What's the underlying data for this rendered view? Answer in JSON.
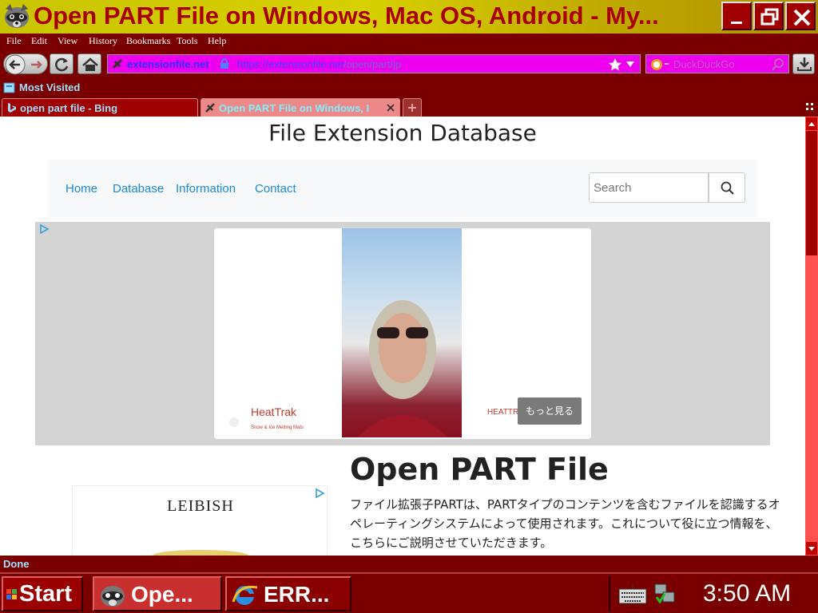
{
  "window": {
    "title": "Open PART File on Windows, Mac OS, Android - My...",
    "controls": [
      "minimize-icon",
      "restore-icon",
      "close-icon"
    ]
  },
  "menu": [
    "File",
    "Edit",
    "View",
    "History",
    "Bookmarks",
    "Tools",
    "Help"
  ],
  "navbar": {
    "domain": "extensionfile.net",
    "url_host": "https://extensionfile.net",
    "url_path": "/open/part/jp",
    "search_placeholder": "DuckDuckGo"
  },
  "bookmarks": {
    "most_visited": "Most Visited"
  },
  "tabs": [
    {
      "label": "open part file - Bing",
      "active": false
    },
    {
      "label": "Open PART File on Windows, I",
      "active": true
    }
  ],
  "page": {
    "site_title": "File Extension Database",
    "nav": [
      "Home",
      "Database",
      "Information",
      "Contact"
    ],
    "search_placeholder": "Search",
    "ad": {
      "brand": "HeatTrak",
      "brand_tagline": "Snow & Ice Melting Mats",
      "brand_right": "HEATTRAK",
      "more_label": "もっと見る"
    },
    "heading": "Open PART File",
    "paragraph": "ファイル拡張子PARTは、PARTタイプのコンテンツを含むファイルを認識するオペレーティングシステムによって使用されます。これについて役に立つ情報を、こちらにご説明させていただきます。",
    "ad2_brand": "LEIBISH"
  },
  "status": "Done",
  "taskbar": {
    "start": "Start",
    "tasks": [
      "Ope...",
      "ERR..."
    ],
    "clock": "3:50 AM"
  },
  "colors": {
    "chrome": "#7a0000",
    "title_text": "#a80000",
    "link": "#1a8bd6",
    "urlbar": "#ee00ee"
  }
}
